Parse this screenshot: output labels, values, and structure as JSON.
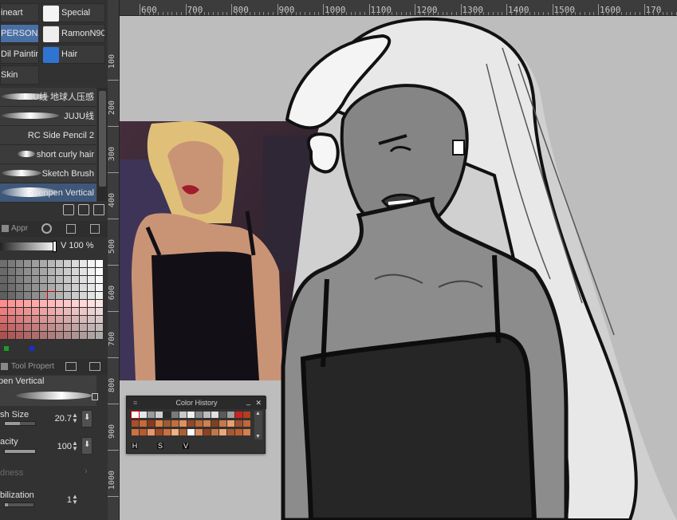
{
  "brush_categories": [
    {
      "label": "ineart",
      "selected": false
    },
    {
      "label": "Special",
      "selected": false
    },
    {
      "label": "PERSONA",
      "selected": true
    },
    {
      "label": "RamonN90",
      "selected": false
    },
    {
      "label": "Dil Painting",
      "selected": false
    },
    {
      "label": "Hair",
      "selected": false
    },
    {
      "label": "Skin",
      "selected": false
    }
  ],
  "brushes": [
    {
      "label": "JUJU线 地球人压感",
      "selected": false
    },
    {
      "label": "JUJU线",
      "selected": false
    },
    {
      "label": "RC Side Pencil 2",
      "selected": false
    },
    {
      "label": "short curly hair",
      "selected": false
    },
    {
      "label": "Sketch Brush",
      "selected": false
    },
    {
      "label": "Gwenpen Vertical",
      "selected": true
    }
  ],
  "color_panel": {
    "tab_label": "Appr",
    "v_label": "V 100 %"
  },
  "tool_property": {
    "tab_label": "Tool Propert",
    "brush_name": "pen Vertical",
    "brush_size_label": "sh Size",
    "brush_size_value": "20.7",
    "opacity_label": "acity",
    "opacity_value": "100",
    "hardness_label": "dness",
    "stabilization_label": "bilization",
    "stabilization_value": "1"
  },
  "ruler": {
    "h_ticks": [
      "600",
      "700",
      "800",
      "900",
      "1000",
      "1100",
      "1200",
      "1300",
      "1400",
      "1500",
      "1600",
      "170"
    ],
    "v_ticks": [
      "100",
      "200",
      "300",
      "400",
      "500",
      "600",
      "700",
      "800",
      "900",
      "1000"
    ]
  },
  "color_history": {
    "title": "Color History",
    "footer": [
      "H",
      "S",
      "V"
    ]
  },
  "colors": {
    "accent": "#4a6fa5",
    "canvas_bg": "#bdbdbd",
    "panel_bg": "#323232"
  }
}
